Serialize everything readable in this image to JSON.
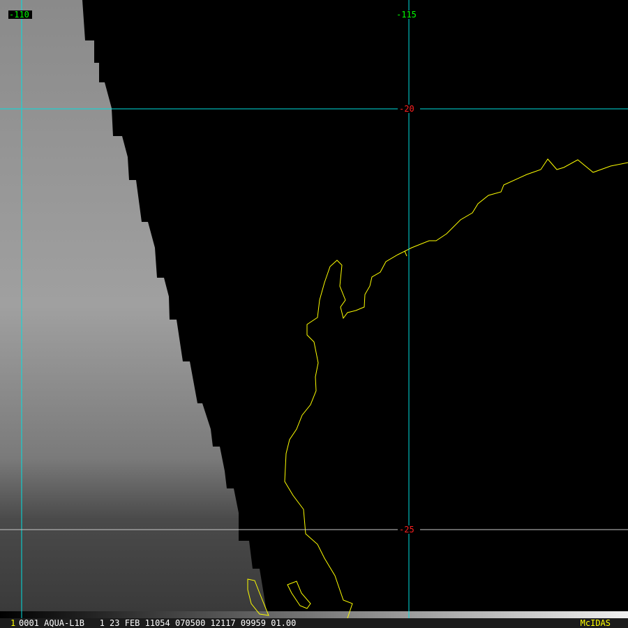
{
  "grid": {
    "lon_labels": [
      "-110",
      "-115"
    ],
    "lat_labels": [
      "-20",
      "-25"
    ]
  },
  "status_bar": {
    "frame_number": "1",
    "info": "0001 AQUA-L1B   1 23 FEB 11054 070500 12117 09959 01.00",
    "brand": "McIDAS"
  },
  "colors": {
    "grid": "#00e0e0",
    "lat_25_line": "#c8c8c8",
    "coastline": "#ffff00",
    "lon_label": "#00ff00",
    "lat_label": "#ff2020",
    "brand": "#ffff00"
  }
}
